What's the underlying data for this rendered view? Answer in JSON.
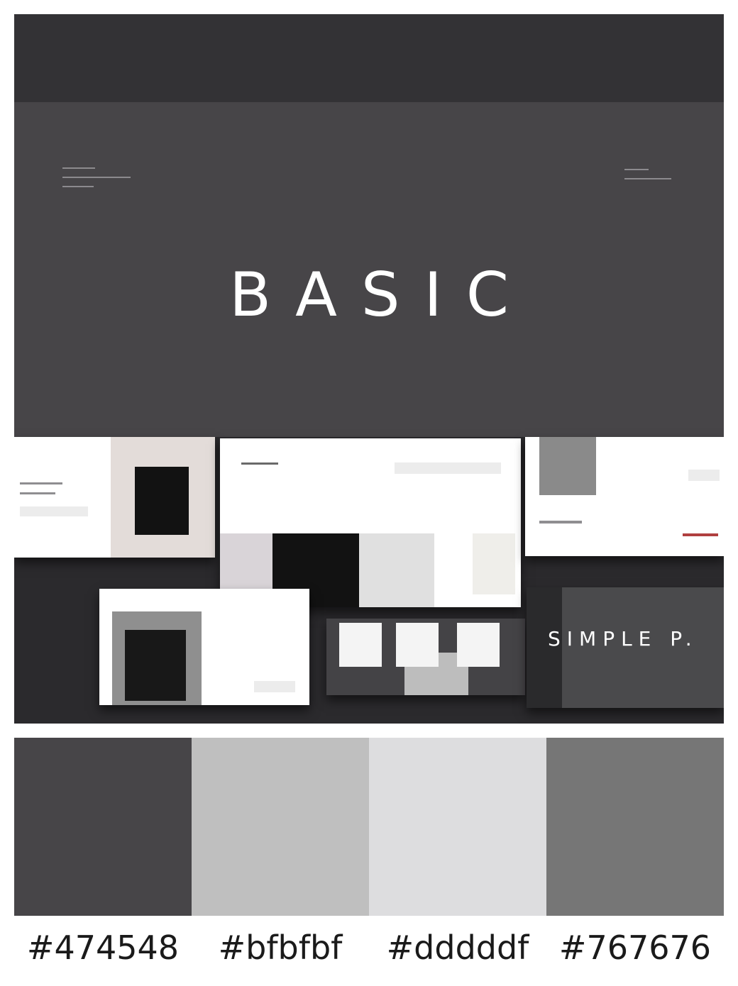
{
  "hero": {
    "title": "BASIC"
  },
  "preview": {
    "slide_text": "SIMPLE P."
  },
  "palette": [
    {
      "hex": "#474548",
      "label": "#474548"
    },
    {
      "hex": "#bfbfbf",
      "label": "#bfbfbf"
    },
    {
      "hex": "#dddddf",
      "label": "#dddddf"
    },
    {
      "hex": "#767676",
      "label": "#767676"
    }
  ]
}
